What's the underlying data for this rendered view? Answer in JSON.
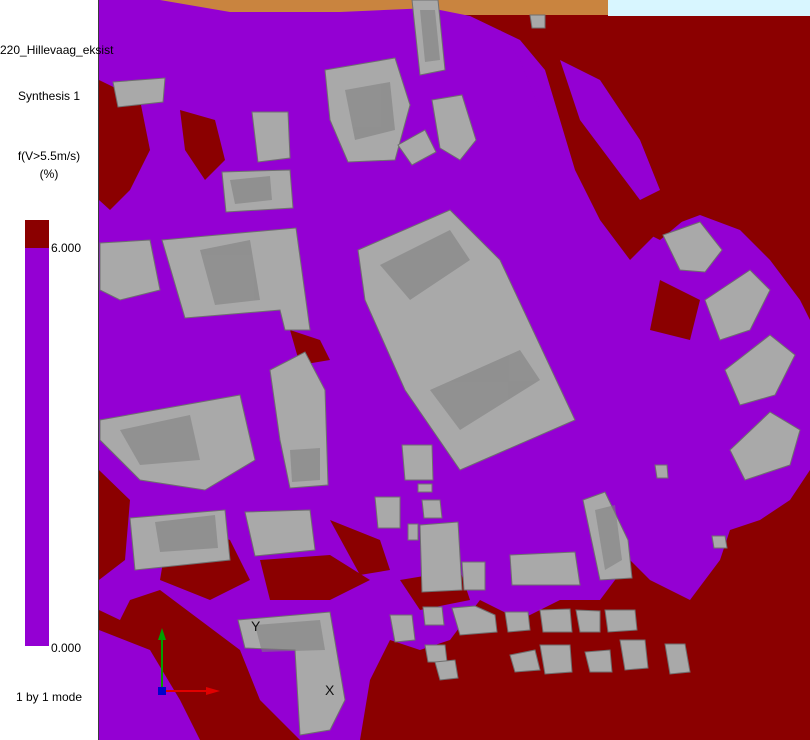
{
  "sidebar": {
    "project_name": "220_Hillevaag_eksist",
    "synthesis": "Synthesis 1",
    "metric": "f(V>5.5m/s)",
    "unit": "(%)",
    "legend": {
      "max_label": "6.000",
      "min_label": "0.000",
      "above_color": "#8b0000",
      "range_color": "#9400d3"
    },
    "mode": "1 by 1 mode"
  },
  "viewport": {
    "axes": {
      "y_label": "Y",
      "x_label": "X",
      "y_color": "#00a000",
      "x_color": "#e00000",
      "z_color": "#0000cc"
    },
    "colors": {
      "high": "#8b0000",
      "low": "#9400d3",
      "building": "#a9a9a9",
      "building_shade": "#7d7d7d",
      "terrain": "#c9843f",
      "sky": "#d8f6ff"
    }
  }
}
